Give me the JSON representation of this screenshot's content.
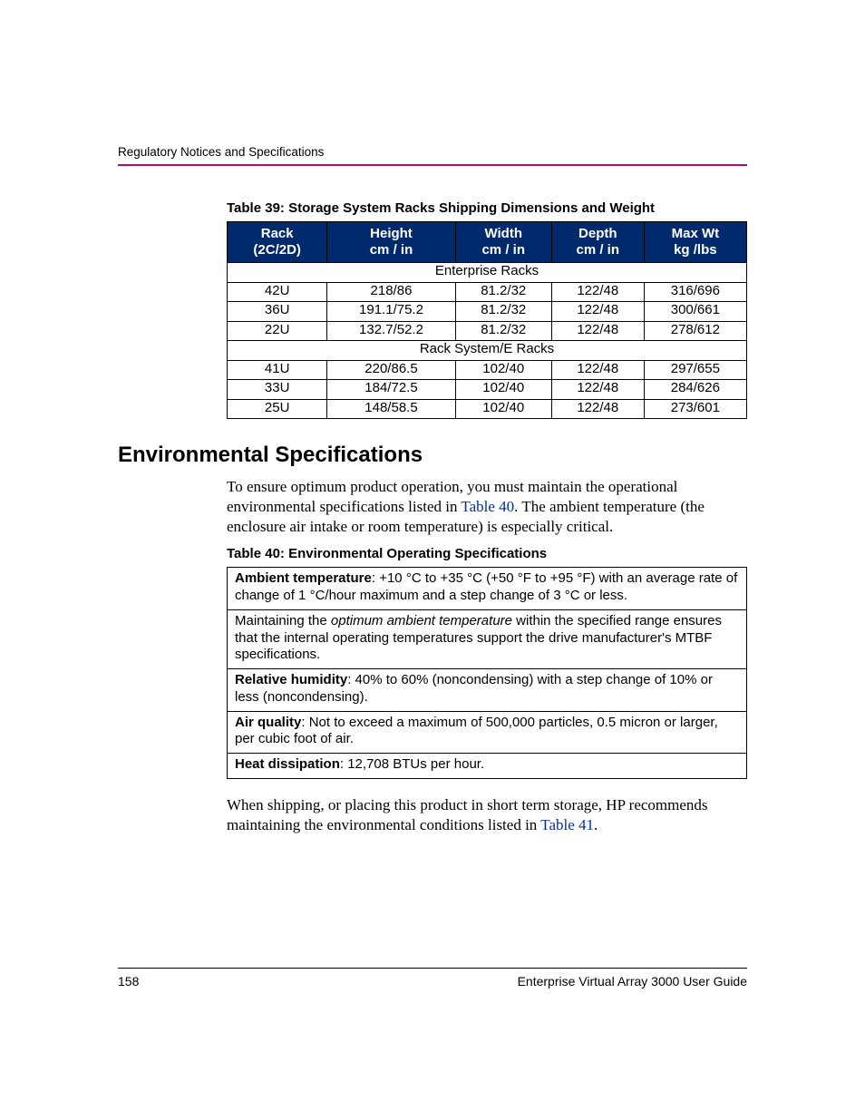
{
  "header": {
    "running_title": "Regulatory Notices and Specifications"
  },
  "table39": {
    "caption": "Table 39:  Storage System Racks Shipping Dimensions and Weight",
    "columns": {
      "c0a": "Rack",
      "c0b": "(2C/2D)",
      "c1a": "Height",
      "c1b": "cm / in",
      "c2a": "Width",
      "c2b": "cm / in",
      "c3a": "Depth",
      "c3b": "cm / in",
      "c4a": "Max Wt",
      "c4b": "kg /lbs"
    },
    "section1": "Enterprise Racks",
    "rows1": [
      {
        "rack": "42U",
        "h": "218/86",
        "w": "81.2/32",
        "d": "122/48",
        "m": "316/696"
      },
      {
        "rack": "36U",
        "h": "191.1/75.2",
        "w": "81.2/32",
        "d": "122/48",
        "m": "300/661"
      },
      {
        "rack": "22U",
        "h": "132.7/52.2",
        "w": "81.2/32",
        "d": "122/48",
        "m": "278/612"
      }
    ],
    "section2": "Rack System/E Racks",
    "rows2": [
      {
        "rack": "41U",
        "h": "220/86.5",
        "w": "102/40",
        "d": "122/48",
        "m": "297/655"
      },
      {
        "rack": "33U",
        "h": "184/72.5",
        "w": "102/40",
        "d": "122/48",
        "m": "284/626"
      },
      {
        "rack": "25U",
        "h": "148/58.5",
        "w": "102/40",
        "d": "122/48",
        "m": "273/601"
      }
    ]
  },
  "section_heading": "Environmental Specifications",
  "para1": {
    "pre_link": "To ensure optimum product operation, you must maintain the operational environmental specifications listed in ",
    "link": "Table 40",
    "post_link": ". The ambient temperature (the enclosure air intake or room temperature) is especially critical."
  },
  "table40": {
    "caption": "Table 40:  Environmental Operating Specifications",
    "ambient_label": "Ambient temperature",
    "ambient_text": ": +10 °C to +35 °C (+50 °F to +95 °F) with an average rate of change of 1 °C/hour maximum and a step change of 3 °C or less.",
    "maintain_pre": "Maintaining the ",
    "maintain_italic": "optimum ambient temperature",
    "maintain_post": " within the specified range ensures that the internal operating temperatures support the drive manufacturer's MTBF specifications.",
    "humidity_label": "Relative humidity",
    "humidity_text": ": 40% to 60% (noncondensing) with a step change of 10% or less (noncondensing).",
    "air_label": "Air quality",
    "air_text": ": Not to exceed a maximum of 500,000 particles, 0.5 micron or larger, per cubic foot of air.",
    "heat_label": "Heat dissipation",
    "heat_text": ": 12,708 BTUs per hour."
  },
  "para2": {
    "pre_link": "When shipping, or placing this product in short term storage, HP recommends maintaining the environmental conditions listed in ",
    "link": "Table 41",
    "post_link": "."
  },
  "footer": {
    "page_number": "158",
    "doc_title": "Enterprise Virtual Array 3000 User Guide"
  }
}
